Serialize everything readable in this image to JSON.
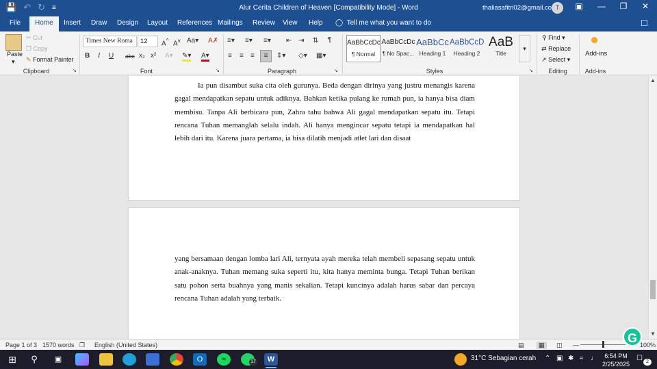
{
  "titlebar": {
    "title": "Alur Cerita Children of Heaven [Compatibility Mode]  -  Word",
    "user": "thaliasafitri02@gmail.com",
    "avatar_initial": "T",
    "icons": [
      "save-icon",
      "undo-icon",
      "redo-icon",
      "customize-qat-icon",
      "ribbon-display-icon",
      "minimize-icon",
      "restore-icon",
      "close-icon"
    ]
  },
  "tabs": [
    "File",
    "Home",
    "Insert",
    "Draw",
    "Design",
    "Layout",
    "References",
    "Mailings",
    "Review",
    "View",
    "Help"
  ],
  "tell_me": "Tell me what you want to do",
  "ribbon": {
    "clipboard": {
      "paste": "Paste",
      "cut": "Cut",
      "copy": "Copy",
      "format_painter": "Format Painter",
      "label": "Clipboard"
    },
    "font": {
      "name": "Times New Roma",
      "size": "12",
      "label": "Font",
      "bold": "B",
      "italic": "I",
      "underline": "U",
      "strike": "abc",
      "sub": "x₂",
      "sup": "x²"
    },
    "paragraph": {
      "label": "Paragraph"
    },
    "styles": {
      "label": "Styles",
      "items": [
        {
          "preview": "AaBbCcDc",
          "name": "¶ Normal"
        },
        {
          "preview": "AaBbCcDc",
          "name": "¶ No Spac..."
        },
        {
          "preview": "AaBbCc",
          "name": "Heading 1"
        },
        {
          "preview": "AaBbCcD",
          "name": "Heading 2"
        },
        {
          "preview": "AaB",
          "name": "Title"
        }
      ]
    },
    "editing": {
      "find": "Find",
      "replace": "Replace",
      "select": "Select",
      "label": "Editing"
    },
    "addins": {
      "button": "Add-ins",
      "label": "Add-ins"
    }
  },
  "document": {
    "page1_text": "Ia pun disambut suka cita oleh gurunya. Beda dengan dirinya yang justru menangis karena gagal mendapatkan sepatu untuk adiknya. Bahkan ketika pulang ke rumah pun, ia hanya bisa diam membisu. Tanpa Ali berbicara pun, Zahra tahu bahwa Ali gagal mendapatkan sepatu itu. Tetapi rencana Tuhan memanglah selalu indah. Ali hanya mengincar sepatu tetapi ia mendapatkan hal lebih dari itu. Karena juara pertama, ia bisa dilatih menjadi atlet lari dan disaat",
    "page2_text": "yang bersamaan dengan lomba lari Ali, ternyata ayah mereka telah membeli sepasang sepatu untuk anak-anaknya. Tuhan memang suka seperti itu, kita hanya meminta bunga. Tetapi Tuhan berikan satu pohon serta buahnya yang manis sekalian. Tetapi kuncinya adalah harus sabar dan percaya rencana Tuhan adalah yang terbaik."
  },
  "statusbar": {
    "page": "Page 1 of 3",
    "words": "1570 words",
    "language": "English (United States)",
    "zoom": "100%"
  },
  "taskbar": {
    "weather": "31°C  Sebagian cerah",
    "time": "6:54 PM",
    "date": "2/25/2025",
    "whatsapp_badge": "17",
    "notification_badge": "2"
  }
}
